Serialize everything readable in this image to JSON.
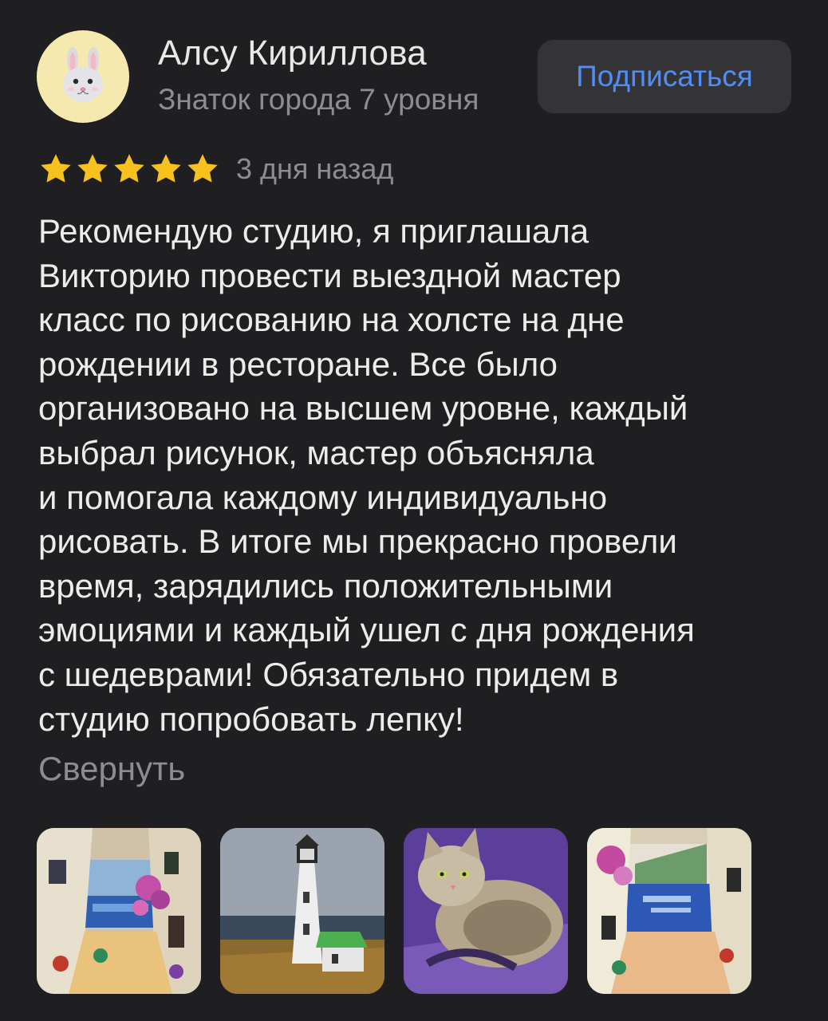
{
  "author": {
    "name": "Алсу Кириллова",
    "level": "Знаток города 7 уровня",
    "avatar_icon": "rabbit-face-icon",
    "avatar_bg": "#f6e9b0"
  },
  "subscribe": {
    "label": "Подписаться",
    "color": "#4f8ef7"
  },
  "rating": {
    "stars": 5,
    "max": 5,
    "color": "#f7c21d"
  },
  "review": {
    "date": "3 дня назад",
    "lines": [
      "Рекомендую студию, я приглашала",
      "Викторию провести выездной мастер",
      "класс по рисованию на холсте на дне",
      "рождении в ресторане. Все было",
      "организовано на высшем уровне, каждый",
      "выбрал рисунок, мастер объясняла",
      "и помогала каждому индивидуально",
      "рисовать. В итоге мы прекрасно провели",
      "время, зарядились положительными",
      "эмоциями и каждый ушел с дня рождения",
      "с шедеврами! Обязательно придем в",
      "студию попробовать лепку!"
    ]
  },
  "collapse_label": "Свернуть",
  "photos": [
    {
      "icon": "painting-street-sea-icon"
    },
    {
      "icon": "painting-lighthouse-icon"
    },
    {
      "icon": "painting-cat-icon"
    },
    {
      "icon": "painting-street-sea-icon"
    }
  ]
}
